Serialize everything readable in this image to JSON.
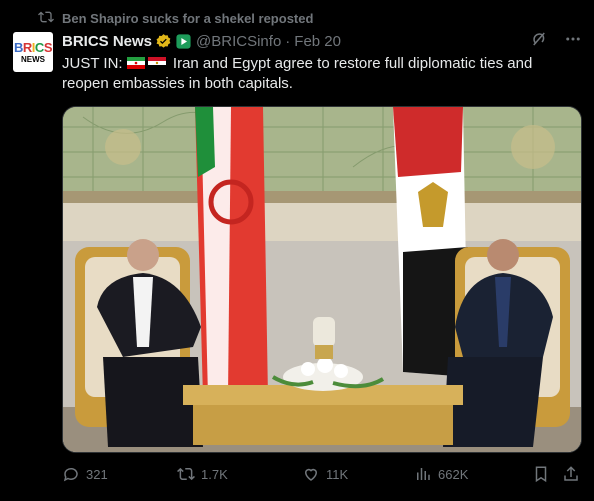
{
  "repost": {
    "text": "Ben Shapiro sucks for a shekel reposted",
    "icon": "repost-icon"
  },
  "author": {
    "avatar_logo": "BRICS",
    "avatar_sub": "NEWS",
    "name": "BRICS News",
    "handle": "@BRICSinfo",
    "separator": "·",
    "date": "Feb 20"
  },
  "tweet": {
    "prefix": "JUST IN:",
    "flags": [
      "iran-flag",
      "egypt-flag"
    ],
    "text": "Iran and Egypt agree to restore full diplomatic ties and reopen embassies in both capitals."
  },
  "actions": {
    "replies": "321",
    "reposts": "1.7K",
    "likes": "11K",
    "views": "662K"
  },
  "colors": {
    "background": "#000000",
    "text": "#e7e9ea",
    "muted": "#71767b",
    "verified_gold": "#e2b719"
  }
}
